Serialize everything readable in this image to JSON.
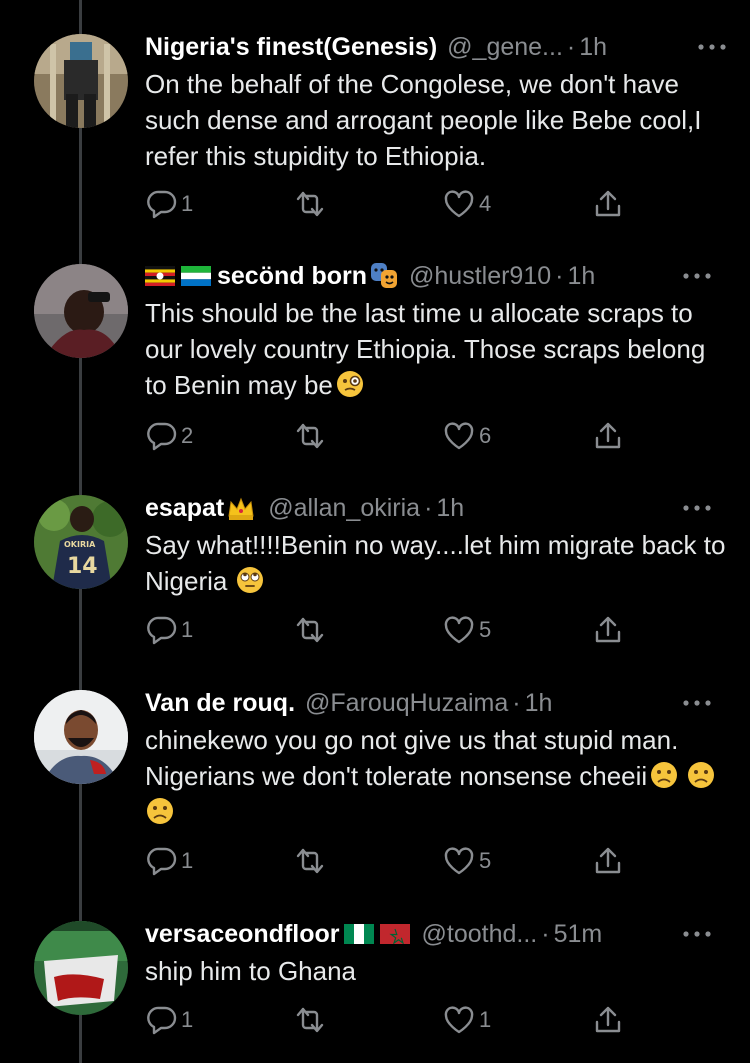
{
  "tweets": [
    {
      "display_name": "Nigeria's finest(Genesis)",
      "handle": "@_gene...",
      "time": "1h",
      "text": "On the behalf of the Congolese, we don't have such dense and arrogant people like Bebe cool,I refer this stupidity to Ethiopia.",
      "replies": "1",
      "retweets": "",
      "likes": "4"
    },
    {
      "display_name": "secönd born",
      "handle": "@hustler910",
      "time": "1h",
      "text": "This should be the last time u allocate scraps to our lovely country Ethiopia. Those scraps belong to Benin may be",
      "replies": "2",
      "retweets": "",
      "likes": "6"
    },
    {
      "display_name": "esapat",
      "handle": "@allan_okiria",
      "time": "1h",
      "text": "Say what!!!!Benin no way....let him migrate back to Nigeria",
      "replies": "1",
      "retweets": "",
      "likes": "5"
    },
    {
      "display_name": "Van de rouq.",
      "handle": "@FarouqHuzaima",
      "time": "1h",
      "text": "chinekewo you go not give us that stupid man. Nigerians we don't tolerate nonsense cheeii",
      "replies": "1",
      "retweets": "",
      "likes": "5"
    },
    {
      "display_name": "versaceondfloor",
      "handle": "@toothd...",
      "time": "51m",
      "text": "ship him to Ghana",
      "replies": "1",
      "retweets": "",
      "likes": "1"
    }
  ],
  "separator": "·",
  "colors": {
    "background": "#000000",
    "text": "#e7e9ea",
    "secondary": "#8a8d91",
    "thread_line": "#3a3d40"
  },
  "icons": [
    "reply-icon",
    "retweet-icon",
    "like-icon",
    "share-icon",
    "more-icon"
  ]
}
